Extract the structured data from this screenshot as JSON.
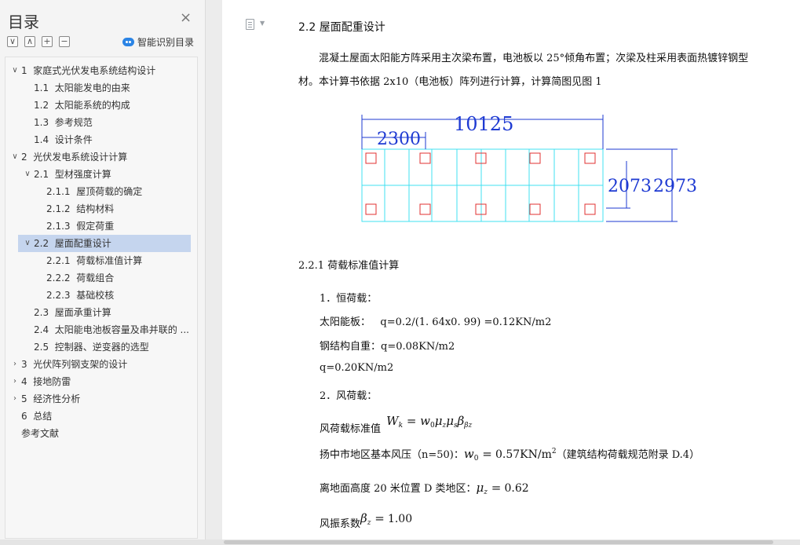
{
  "sidebar": {
    "title": "目录",
    "close_glyph": "×",
    "toolbar": [
      "∨",
      "∧",
      "+",
      "−"
    ],
    "smart_toc_label": "智能识别目录",
    "toc": [
      {
        "arrow": "∨",
        "num": "1",
        "label": "家庭式光伏发电系统结构设计",
        "level": 0
      },
      {
        "arrow": "",
        "num": "1.1",
        "label": "太阳能发电的由来",
        "level": 1
      },
      {
        "arrow": "",
        "num": "1.2",
        "label": "太阳能系统的构成",
        "level": 1
      },
      {
        "arrow": "",
        "num": "1.3",
        "label": "参考规范",
        "level": 1
      },
      {
        "arrow": "",
        "num": "1.4",
        "label": "设计条件",
        "level": 1
      },
      {
        "arrow": "∨",
        "num": "2",
        "label": "光伏发电系统设计计算",
        "level": 0
      },
      {
        "arrow": "∨",
        "num": "2.1",
        "label": "型材强度计算",
        "level": 1
      },
      {
        "arrow": "",
        "num": "2.1.1",
        "label": "屋顶荷载的确定",
        "level": 2
      },
      {
        "arrow": "",
        "num": "2.1.2",
        "label": "结构材料",
        "level": 2
      },
      {
        "arrow": "",
        "num": "2.1.3",
        "label": "假定荷重",
        "level": 2
      },
      {
        "arrow": "∨",
        "num": "2.2",
        "label": "屋面配重设计",
        "level": 1,
        "selected": true
      },
      {
        "arrow": "",
        "num": "2.2.1",
        "label": "荷载标准值计算",
        "level": 2
      },
      {
        "arrow": "",
        "num": "2.2.2",
        "label": "荷载组合",
        "level": 2
      },
      {
        "arrow": "",
        "num": "2.2.3",
        "label": "基础校核",
        "level": 2
      },
      {
        "arrow": "",
        "num": "2.3",
        "label": "屋面承重计算",
        "level": 1
      },
      {
        "arrow": "",
        "num": "2.4",
        "label": "太阳能电池板容量及串并联的 ...",
        "level": 1
      },
      {
        "arrow": "",
        "num": "2.5",
        "label": "控制器、逆变器的选型",
        "level": 1
      },
      {
        "arrow": "›",
        "num": "3",
        "label": "光伏阵列钢支架的设计",
        "level": 0
      },
      {
        "arrow": "›",
        "num": "4",
        "label": "接地防雷",
        "level": 0
      },
      {
        "arrow": "›",
        "num": "5",
        "label": "经济性分析",
        "level": 0
      },
      {
        "arrow": "",
        "num": "6",
        "label": "总结",
        "level": 0
      },
      {
        "arrow": "",
        "num": "",
        "label": "参考文献",
        "level": 0
      }
    ]
  },
  "document": {
    "heading": "2.2  屋面配重设计",
    "intro_paragraph": "混凝土屋面太阳能方阵采用主次梁布置，电池板以 25°倾角布置；次梁及柱采用表面热镀锌钢型材。本计算书依据 2x10（电池板）阵列进行计算，计算简图见图 1",
    "diagram_labels": {
      "total_width": "10125",
      "bay_width": "2300",
      "depth_inner": "2073",
      "depth_outer": "2973"
    },
    "subheading": "2.2.1 荷载标准值计算",
    "dead_load_title": "1．恒荷载：",
    "solar_panel_label": "太阳能板：",
    "solar_panel_value": "q=0.2/(1. 64x0. 99) =0.12KN/m2",
    "steel_self_weight": "钢结构自重：q=0.08KN/m2",
    "dead_load_total": "q=0.20KN/m2",
    "wind_load_title": "2．风荷载：",
    "wind_std_label": "风荷载标准值",
    "basic_wind_label": "扬中市地区基本风压（n=50)：",
    "basic_wind_value": "0.57KN/m",
    "basic_wind_ref": "（建筑结构荷载规范附录 D.4）",
    "height_label": "离地面高度 20 米位置  D 类地区：",
    "height_value": "0.62",
    "gust_label": "风振系数",
    "gust_value": "1.00"
  },
  "colors": {
    "diagram_grid": "#40e0f0",
    "diagram_marker": "#e03030",
    "diagram_dim": "#1e3ad2",
    "toc_selected_bg": "#c5d5ee"
  }
}
